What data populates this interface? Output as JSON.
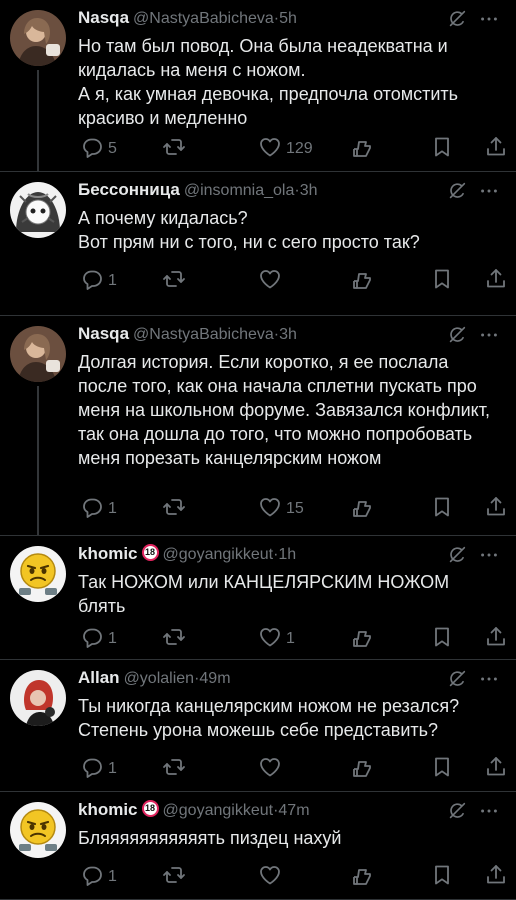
{
  "tweets": [
    {
      "name": "Nasqa",
      "badge": "",
      "handle": "@NastyaBabicheva",
      "dot": "·",
      "time": "5h",
      "text": "Но там был повод. Она была неадекватна и кидалась на меня с ножом.\nА я, как умная девочка, предпочла отомстить красиво и медленно",
      "replies": "5",
      "retweets": "",
      "likes": "129",
      "avatar": "woman-photo-avatar"
    },
    {
      "name": "Бессонница",
      "badge": "",
      "handle": "@insomnia_ola",
      "dot": "·",
      "time": "3h",
      "text": "А почему кидалась?\nВот прям ни с того, ни с сего просто так?",
      "replies": "1",
      "retweets": "",
      "likes": "",
      "avatar": "anime-drawing-avatar"
    },
    {
      "name": "Nasqa",
      "badge": "",
      "handle": "@NastyaBabicheva",
      "dot": "·",
      "time": "3h",
      "text": "Долгая история. Если коротко, я ее послала после того, как она начала сплетни пускать про меня на школьном форуме. Завязался конфликт, так она дошла до того, что можно попробовать меня порезать канцелярским ножом",
      "replies": "1",
      "retweets": "",
      "likes": "15",
      "avatar": "woman-photo-avatar"
    },
    {
      "name": "khomic",
      "badge": "18",
      "handle": "@goyangikkeut",
      "dot": "·",
      "time": "1h",
      "text": "Так НОЖОМ или КАНЦЕЛЯРСКИМ НОЖОМ блять",
      "replies": "1",
      "retweets": "",
      "likes": "1",
      "avatar": "emoji-face-avatar"
    },
    {
      "name": "Allan",
      "badge": "",
      "handle": "@yolalien",
      "dot": "·",
      "time": "49m",
      "text": "Ты никогда канцелярским ножом не резался? Степень урона можешь себе представить?",
      "replies": "1",
      "retweets": "",
      "likes": "",
      "avatar": "redhead-photo-avatar"
    },
    {
      "name": "khomic",
      "badge": "18",
      "handle": "@goyangikkeut",
      "dot": "·",
      "time": "47m",
      "text": "Бляяяяяяяяяяять пиздец нахуй",
      "replies": "1",
      "retweets": "",
      "likes": "",
      "avatar": "emoji-face-avatar"
    }
  ],
  "icons": {
    "grok": "grok-icon",
    "more": "more-icon",
    "reply": "reply-icon",
    "retweet": "retweet-icon",
    "like": "like-icon",
    "stats": "stats-icon",
    "bookmark": "bookmark-icon",
    "share": "share-icon"
  },
  "colors": {
    "background": "#000000",
    "text": "#e7e9ea",
    "muted": "#71767b",
    "divider": "#2f3336"
  }
}
